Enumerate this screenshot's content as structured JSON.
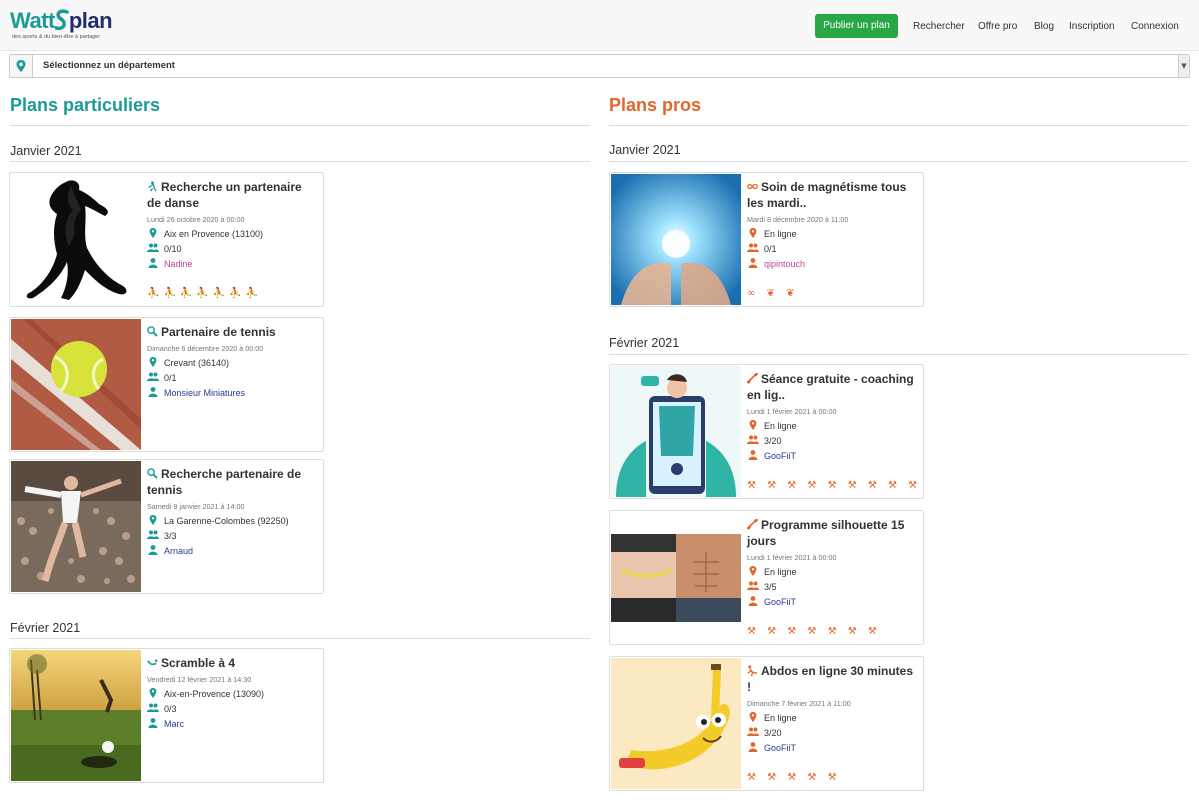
{
  "header": {
    "logo_text_a": "Watt",
    "logo_text_b": "plan",
    "tagline": "des sports & du bien-être à partager",
    "publish_button": "Publier un plan",
    "nav": [
      "Rechercher",
      "Offre pro",
      "Blog",
      "Inscription",
      "Connexion"
    ]
  },
  "department_select": {
    "selected": "Sélectionnez un département"
  },
  "colors": {
    "teal": "#1a9b96",
    "orange": "#e5652a",
    "green_button": "#28a745",
    "user_link": "#2a3b8f"
  },
  "particuliers": {
    "title": "Plans particuliers",
    "months": [
      "Janvier 2021",
      "Février 2021"
    ],
    "cards": [
      {
        "title": "Recherche un partenaire de danse",
        "date": "Lundi 26 octobre 2020 à 00:00",
        "location": "Aix en Provence (13100)",
        "participants": "0/10",
        "user": "Nadine",
        "icon": "dance-icon",
        "activities": "⛹⛹⛹⛹⛹⛹⛹"
      },
      {
        "title": "Partenaire de tennis",
        "date": "Dimanche 6 décembre 2020 à 00:00",
        "location": "Crevant (36140)",
        "participants": "0/1",
        "user": "Monsieur Miniatures",
        "icon": "tennis-icon"
      },
      {
        "title": "Recherche partenaire de tennis",
        "date": "Samedi 9 janvier 2021 à 14:00",
        "location": "La Garenne-Colombes (92250)",
        "participants": "3/3",
        "user": "Arnaud",
        "icon": "tennis-icon"
      },
      {
        "title": "Scramble à 4",
        "date": "Vendredi 12 février 2021 à 14:30",
        "location": "Aix-en-Provence (13090)",
        "participants": "0/3",
        "user": "Marc",
        "icon": "golf-icon"
      }
    ]
  },
  "pros": {
    "title": "Plans pros",
    "months": [
      "Janvier 2021",
      "Février 2021"
    ],
    "cards": [
      {
        "title": "Soin de magnétisme tous les mardi..",
        "date": "Mardi 8 décembre 2020 à 11:00",
        "location": "En ligne",
        "participants": "0/1",
        "user": "qipintouch",
        "icon": "infinity-icon",
        "activities": "∞ ❦ ❦"
      },
      {
        "title": "Séance gratuite - coaching en lig..",
        "date": "Lundi 1 février 2021 à 00:00",
        "location": "En ligne",
        "participants": "3/20",
        "user": "GooFiiT",
        "icon": "dumbbell-icon",
        "activities": "⚒ ⚒ ⚒ ⚒ ⚒ ⚒ ⚒ ⚒ ⚒"
      },
      {
        "title": "Programme silhouette 15 jours",
        "date": "Lundi 1 février 2021 à 00:00",
        "location": "En ligne",
        "participants": "3/5",
        "user": "GooFiiT",
        "icon": "dumbbell-icon",
        "activities": "⚒ ⚒ ⚒ ⚒ ⚒ ⚒ ⚒"
      },
      {
        "title": "Abdos en ligne 30 minutes !",
        "date": "Dimanche 7 février 2021 à 11:00",
        "location": "En ligne",
        "participants": "3/20",
        "user": "GooFiiT",
        "icon": "fitness-icon",
        "activities": "⚒ ⚒ ⚒ ⚒ ⚒"
      }
    ]
  }
}
